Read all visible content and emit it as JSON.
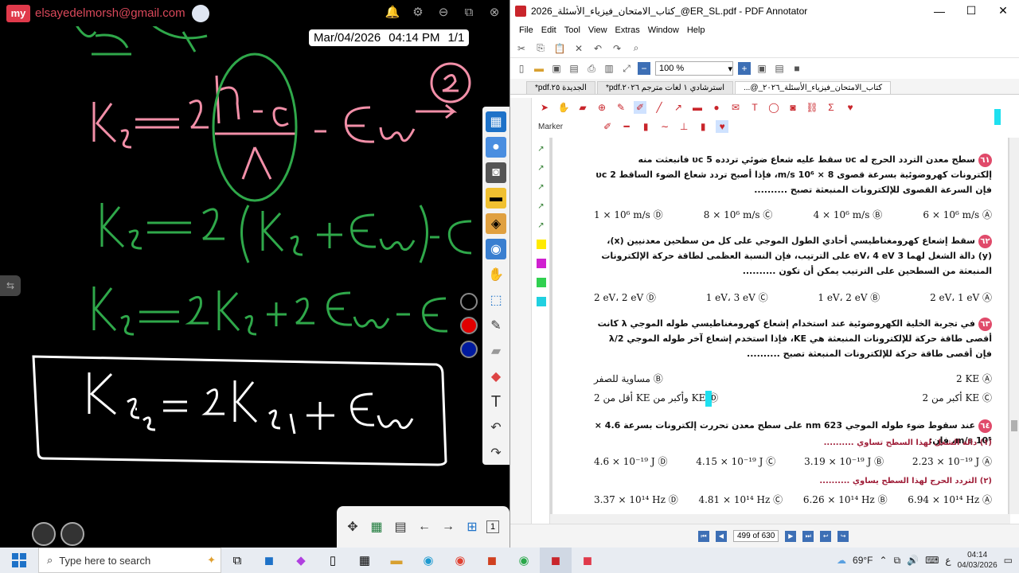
{
  "board": {
    "email": "elsayedelmorsh@gmail.com",
    "logo_text": "my",
    "date": "Mar/04/2026",
    "time": "04:14 PM",
    "page_counter": "1/1",
    "page_indicator": "1",
    "ink_colors": {
      "pink": "#f28fa8",
      "green": "#2fa84a",
      "white": "#ffffff"
    },
    "color_dots": [
      "#000000",
      "#e00000",
      "#001a9e"
    ]
  },
  "pdf": {
    "title": "كتاب_الامتحان_فيزياء_الأسئلة_2026_@ER_SL.pdf - PDF Annotator",
    "menu": [
      "File",
      "Edit",
      "Tool",
      "View",
      "Extras",
      "Window",
      "Help"
    ],
    "zoom": "100 %",
    "tabs": [
      "الجديدة ٢٥.pdf*",
      "استرشادي ١ لغات مترجم ٢٠٢٦.pdf*",
      "كتاب_الامتحان_فيزياء_الأسئلة_٢٠٢٦_@..."
    ],
    "marker_label": "Marker",
    "status": {
      "page": "499 of 630"
    }
  },
  "questions": [
    {
      "num": "٦١",
      "text": "سطح معدن التردد الحرج له υc سقط عليه شعاع ضوئي تردده 5 υc فانبعثت منه إلكترونات كهروضوئية بسرعة قصوى 8 × 10⁶ m/s، فإذا أصبح تردد شعاع الضوء الساقط 2 υc فإن السرعة القصوى للإلكترونات المنبعثة تصبح ..........",
      "options": [
        "6 × 10⁶ m/s Ⓐ",
        "4 × 10⁶ m/s Ⓑ",
        "8 × 10⁶ m/s Ⓒ",
        "1 × 10⁶ m/s Ⓓ"
      ]
    },
    {
      "num": "٦٢",
      "text": "سقط إشعاع كهرومغناطيسي أحادي الطول الموجي على كل من سطحين معدنيين (x)، (y) دالة الشغل لهما 3 eV، 4 eV على الترتيب، فإن النسبة العظمى لطاقة حركة الإلكترونات المنبعثة من السطحين على الترتيب يمكن أن تكون ..........",
      "options": [
        "2 eV، 1 eV Ⓐ",
        "1 eV، 2 eV Ⓑ",
        "1 eV، 3 eV Ⓒ",
        "2 eV، 2 eV Ⓓ"
      ]
    },
    {
      "num": "٦٣",
      "text": "في تجربة الخلية الكهروضوئية عند استخدام إشعاع كهرومغناطيسي طوله الموجي λ كانت أقصى طاقة حركة للإلكترونات المنبعثة هي KE، فإذا استخدم إشعاع آخر طوله الموجي λ/2 فإن أقصى طاقة حركة للإلكترونات المنبعثة تصبح ..........",
      "options": [
        "2 KE Ⓐ",
        "مساوية للصفر Ⓑ",
        "أكبر من 2 KE Ⓒ",
        "أقل من 2 KE وأكبر من KE Ⓓ"
      ]
    },
    {
      "num": "٦٤",
      "text": "عند سقوط ضوء طوله الموجي 623 nm على سطح معدن تحررت إلكترونات بسرعة 4.6 × 10⁵ m/s، فإن:",
      "sub1": "(١) دالة الشغل لهذا السطح تساوي ..........",
      "options1": [
        "2.23 × 10⁻¹⁹ J Ⓐ",
        "3.19 × 10⁻¹⁹ J Ⓑ",
        "4.15 × 10⁻¹⁹ J Ⓒ",
        "4.6 × 10⁻¹⁹ J Ⓓ"
      ],
      "sub2": "(٢) التردد الحرج لهذا السطح يساوي ..........",
      "options2": [
        "6.94 × 10¹⁴ Hz Ⓐ",
        "6.26 × 10¹⁴ Hz Ⓑ",
        "4.81 × 10¹⁴ Hz Ⓒ",
        "3.37 × 10¹⁴ Hz Ⓓ"
      ]
    }
  ],
  "taskbar": {
    "search_placeholder": "Type here to search",
    "weather": "69°F",
    "time": "04:14",
    "date": "04/03/2026",
    "lang": "ع"
  }
}
